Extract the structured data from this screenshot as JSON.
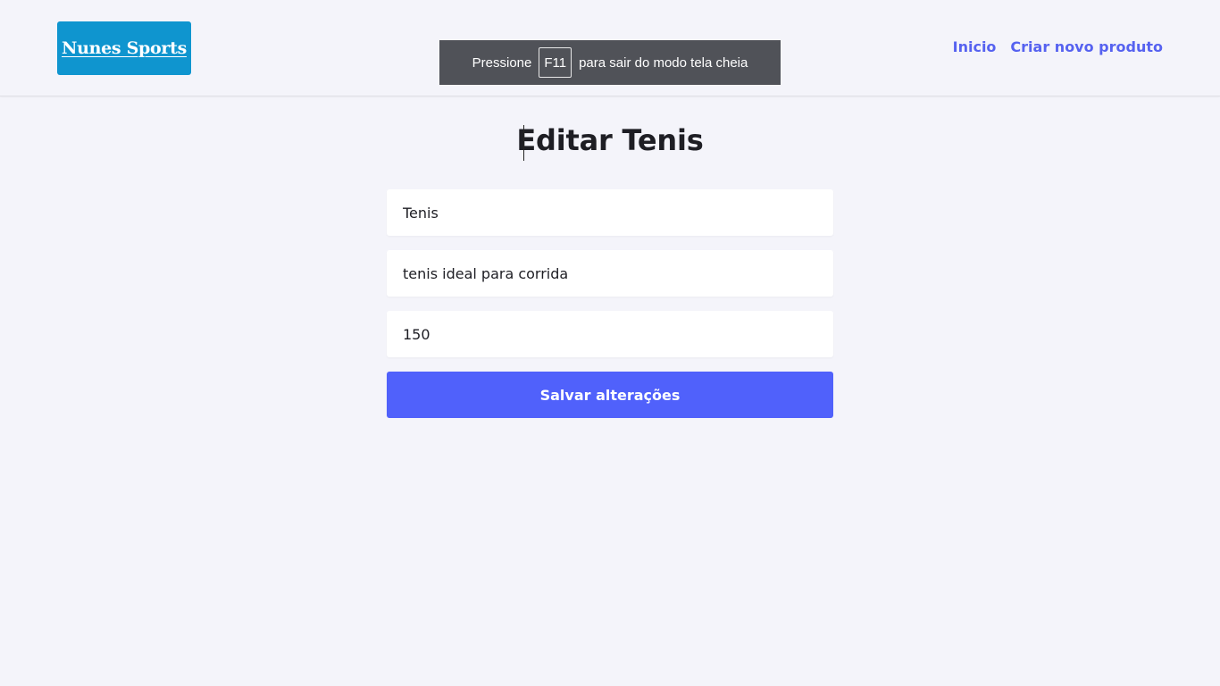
{
  "brand": {
    "logo_text": "Nunes Sports",
    "logo_color": "#0f95cf"
  },
  "fullscreen_notice": {
    "before": "Pressione",
    "key": "F11",
    "after": "para sair do modo tela cheia"
  },
  "nav": {
    "items": [
      {
        "label": "Inicio"
      },
      {
        "label": "Criar novo produto"
      }
    ],
    "accent_color": "#5662f0"
  },
  "main": {
    "title": "Editar Tenis",
    "form": {
      "name_value": "Tenis",
      "description_value": "tenis ideal para corrida",
      "price_value": "150",
      "submit_label": "Salvar alterações",
      "submit_color": "#5061fb"
    }
  }
}
